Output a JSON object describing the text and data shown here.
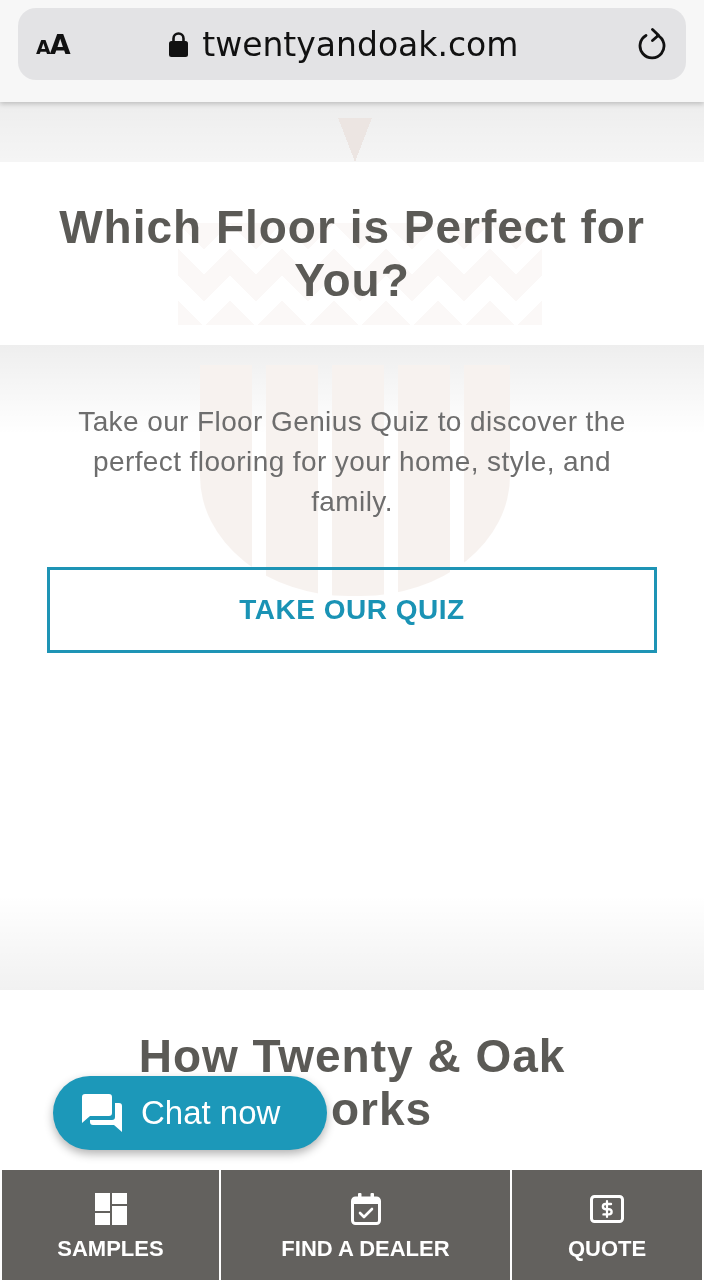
{
  "browser_bar": {
    "text_size_button": "AA",
    "url": "twentyandoak.com"
  },
  "quiz_section": {
    "heading": "Which Floor is Perfect for You?",
    "description": "Take our Floor Genius Quiz to discover the perfect flooring for your home, style, and family.",
    "button": "TAKE OUR QUIZ"
  },
  "how_it_works": {
    "heading_lines": [
      "How Twenty & Oak",
      "orks"
    ]
  },
  "chat_button": {
    "label": "Chat now"
  },
  "bottom_nav": [
    {
      "kind": "samples",
      "label": "SAMPLES"
    },
    {
      "kind": "dealer",
      "label": "FIND A DEALER"
    },
    {
      "kind": "quote",
      "label": "QUOTE"
    }
  ]
}
